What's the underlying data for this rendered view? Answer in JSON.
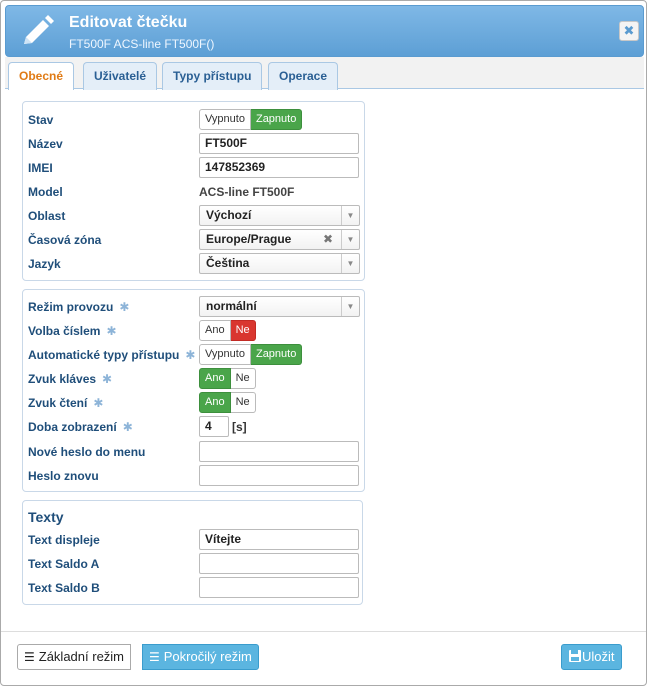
{
  "dialog": {
    "title": "Editovat čtečku",
    "subtitle": "FT500F ACS-line FT500F()",
    "close_icon": "close-icon",
    "edit_icon": "pencil-icon"
  },
  "tabs": [
    {
      "label": "Obecné",
      "active": true
    },
    {
      "label": "Uživatelé",
      "active": false
    },
    {
      "label": "Typy přístupu",
      "active": false
    },
    {
      "label": "Operace",
      "active": false
    }
  ],
  "general": {
    "stav": {
      "label": "Stav",
      "off": "Vypnuto",
      "on": "Zapnuto",
      "value": "Zapnuto"
    },
    "nazev": {
      "label": "Název",
      "value": "FT500F"
    },
    "imei": {
      "label": "IMEI",
      "value": "147852369"
    },
    "model": {
      "label": "Model",
      "value": "ACS-line FT500F"
    },
    "oblast": {
      "label": "Oblast",
      "value": "Výchozí"
    },
    "casova_zona": {
      "label": "Časová zóna",
      "value": "Europe/Prague"
    },
    "jazyk": {
      "label": "Jazyk",
      "value": "Čeština"
    }
  },
  "mode": {
    "rezim_provozu": {
      "label": "Režim provozu",
      "value": "normální"
    },
    "volba_cislem": {
      "label": "Volba číslem",
      "yes": "Ano",
      "no": "Ne",
      "value": "Ne"
    },
    "auto_typy": {
      "label": "Automatické typy přístupu",
      "off": "Vypnuto",
      "on": "Zapnuto",
      "value": "Zapnuto"
    },
    "zvuk_klaves": {
      "label": "Zvuk kláves",
      "yes": "Ano",
      "no": "Ne",
      "value": "Ano"
    },
    "zvuk_cteni": {
      "label": "Zvuk čtení",
      "yes": "Ano",
      "no": "Ne",
      "value": "Ano"
    },
    "doba_zobrazeni": {
      "label": "Doba zobrazení",
      "value": "4",
      "unit": "[s]"
    },
    "nove_heslo": {
      "label": "Nové heslo do menu",
      "value": ""
    },
    "heslo_znovu": {
      "label": "Heslo znovu",
      "value": ""
    }
  },
  "texty": {
    "heading": "Texty",
    "displej": {
      "label": "Text displeje",
      "value": "Vítejte"
    },
    "saldo_a": {
      "label": "Text Saldo A",
      "value": ""
    },
    "saldo_b": {
      "label": "Text Saldo B",
      "value": ""
    }
  },
  "footer": {
    "basic_mode": "Základní režim",
    "advanced_mode": "Pokročilý režim",
    "save": "Uložit"
  },
  "colors": {
    "accent_blue": "#5d9fd5",
    "active_green": "#4aa54a",
    "active_red": "#d9362f",
    "active_tab": "#e07b16"
  }
}
